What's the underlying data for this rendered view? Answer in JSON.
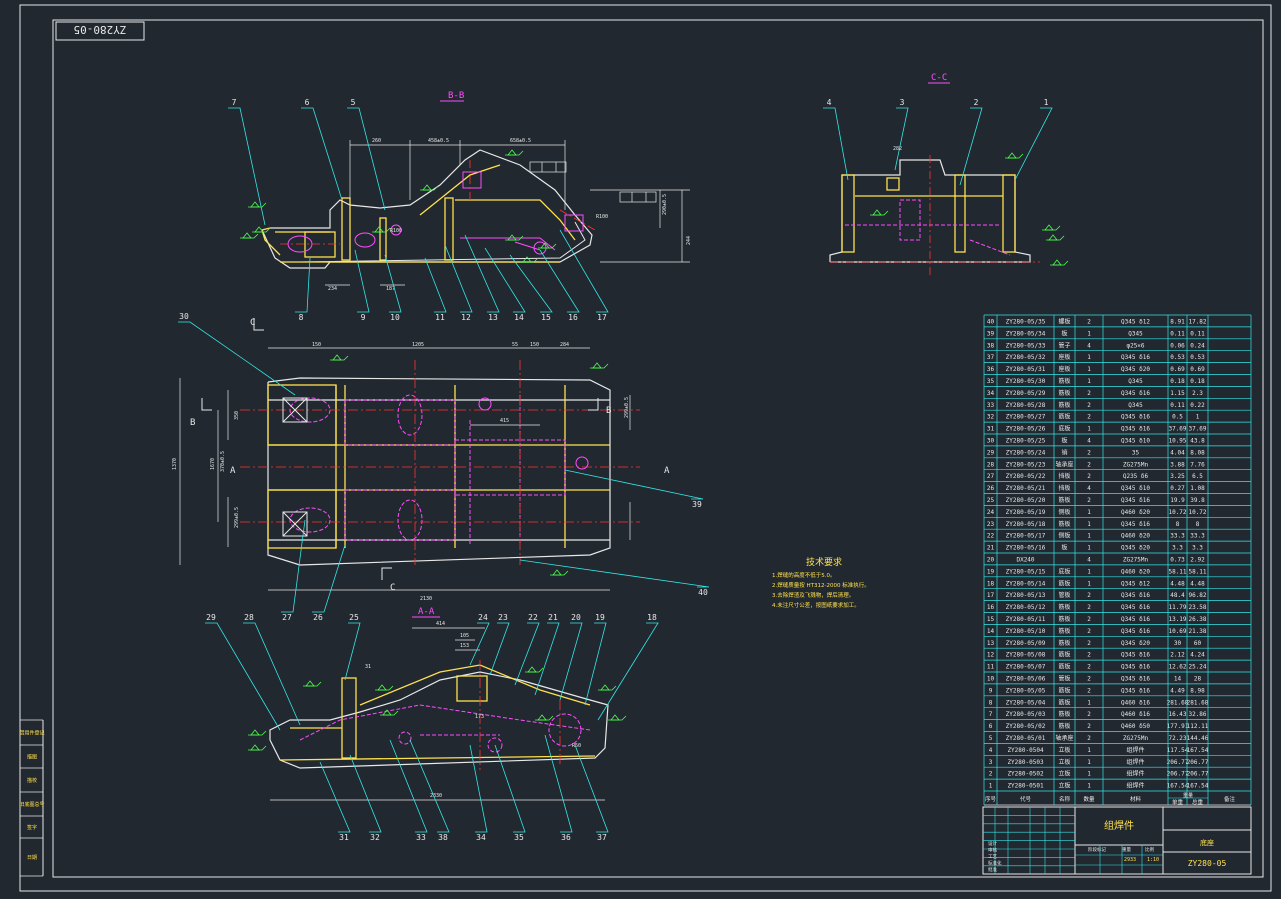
{
  "sheet_code": "ZY280-05",
  "views": {
    "bb": "B-B",
    "cc": "C-C",
    "aa": "A-A",
    "sec_a": "A",
    "sec_b": "B",
    "sec_c": "C"
  },
  "dims": {
    "bb": [
      "260",
      "458±0.5",
      "658±0.5",
      "290±0.5",
      "244",
      "234",
      "187",
      "R100",
      "R100"
    ],
    "plan": [
      "150",
      "1205",
      "55",
      "150",
      "284",
      "2130",
      "1370",
      "1670",
      "415",
      "350",
      "370±0.5",
      "299±0.5",
      "299±0.5"
    ],
    "aa": [
      "414",
      "105",
      "153",
      "2330",
      "31",
      "173",
      "R50"
    ],
    "cc": [
      "282"
    ]
  },
  "balloons_bb": [
    "7",
    "6",
    "5",
    "8",
    "9",
    "10",
    "11",
    "12",
    "13",
    "14",
    "15",
    "16",
    "17"
  ],
  "balloons_cc": [
    "4",
    "3",
    "2",
    "1"
  ],
  "balloons_plan": [
    "30",
    "27",
    "26",
    "39",
    "40"
  ],
  "balloons_aa": [
    "29",
    "28",
    "25",
    "24",
    "23",
    "22",
    "21",
    "20",
    "19",
    "18",
    "31",
    "32",
    "33",
    "38",
    "34",
    "35",
    "36",
    "37"
  ],
  "tech_req": {
    "title": "技术要求",
    "lines": [
      "1.焊缝的高度不低于5.0。",
      "2.焊缝质量按 HT312-2000 标准执行。",
      "3.去除焊渣及飞溅物，焊后清理。",
      "4.未注尺寸公差，按图纸要求加工。"
    ]
  },
  "bom_rows": [
    [
      "40",
      "ZY280-05/35",
      "螺板",
      "2",
      "Q345 δ12",
      "8.91",
      "17.82"
    ],
    [
      "39",
      "ZY280-05/34",
      "板",
      "1",
      "Q345",
      "0.11",
      "0.11"
    ],
    [
      "38",
      "ZY280-05/33",
      "管子",
      "4",
      "φ25×6",
      "0.06",
      "0.24"
    ],
    [
      "37",
      "ZY280-05/32",
      "座板",
      "1",
      "Q345 δ16",
      "0.53",
      "0.53"
    ],
    [
      "36",
      "ZY280-05/31",
      "座板",
      "1",
      "Q345 δ20",
      "0.69",
      "0.69"
    ],
    [
      "35",
      "ZY280-05/30",
      "筋板",
      "1",
      "Q345",
      "0.18",
      "0.18"
    ],
    [
      "34",
      "ZY280-05/29",
      "筋板",
      "2",
      "Q345 δ16",
      "1.15",
      "2.3"
    ],
    [
      "33",
      "ZY280-05/28",
      "筋板",
      "2",
      "Q345",
      "0.11",
      "0.22"
    ],
    [
      "32",
      "ZY280-05/27",
      "筋板",
      "2",
      "Q345 δ16",
      "0.5",
      "1"
    ],
    [
      "31",
      "ZY280-05/26",
      "底板",
      "1",
      "Q345 δ16",
      "37.69",
      "37.69"
    ],
    [
      "30",
      "ZY280-05/25",
      "板",
      "4",
      "Q345 δ10",
      "10.95",
      "43.8"
    ],
    [
      "29",
      "ZY280-05/24",
      "销",
      "2",
      "35",
      "4.04",
      "8.08"
    ],
    [
      "28",
      "ZY280-05/23",
      "轴承座",
      "2",
      "ZG275Mn",
      "3.88",
      "7.76"
    ],
    [
      "27",
      "ZY280-05/22",
      "挡板",
      "2",
      "Q235 δ6",
      "3.25",
      "6.5"
    ],
    [
      "26",
      "ZY280-05/21",
      "挡板",
      "4",
      "Q345 δ10",
      "0.27",
      "1.08"
    ],
    [
      "25",
      "ZY280-05/20",
      "筋板",
      "2",
      "Q345 δ16",
      "19.9",
      "39.8"
    ],
    [
      "24",
      "ZY280-05/19",
      "侧板",
      "1",
      "Q460 δ20",
      "10.72",
      "10.72"
    ],
    [
      "23",
      "ZY280-05/18",
      "筋板",
      "1",
      "Q345 δ16",
      "8",
      "8"
    ],
    [
      "22",
      "ZY280-05/17",
      "侧板",
      "1",
      "Q460 δ20",
      "33.3",
      "33.3"
    ],
    [
      "21",
      "ZY280-05/16",
      "板",
      "1",
      "Q345 δ20",
      "3.3",
      "3.3"
    ],
    [
      "20",
      "DX240",
      "",
      "4",
      "ZG275Mn",
      "0.73",
      "2.92"
    ],
    [
      "19",
      "ZY280-05/15",
      "底板",
      "1",
      "Q460 δ20",
      "58.11",
      "58.11"
    ],
    [
      "18",
      "ZY280-05/14",
      "筋板",
      "1",
      "Q345 δ12",
      "4.48",
      "4.48"
    ],
    [
      "17",
      "ZY280-05/13",
      "管板",
      "2",
      "Q345 δ16",
      "48.4",
      "96.82"
    ],
    [
      "16",
      "ZY280-05/12",
      "筋板",
      "2",
      "Q345 δ16",
      "11.79",
      "23.58"
    ],
    [
      "15",
      "ZY280-05/11",
      "筋板",
      "2",
      "Q345 δ16",
      "13.19",
      "26.38"
    ],
    [
      "14",
      "ZY280-05/10",
      "筋板",
      "2",
      "Q345 δ16",
      "10.69",
      "21.38"
    ],
    [
      "13",
      "ZY280-05/09",
      "筋板",
      "2",
      "Q345 δ20",
      "30",
      "60"
    ],
    [
      "12",
      "ZY280-05/08",
      "筋板",
      "2",
      "Q345 δ16",
      "2.12",
      "4.24"
    ],
    [
      "11",
      "ZY280-05/07",
      "筋板",
      "2",
      "Q345 δ16",
      "12.62",
      "25.24"
    ],
    [
      "10",
      "ZY280-05/06",
      "管板",
      "2",
      "Q345 δ16",
      "14",
      "28"
    ],
    [
      "9",
      "ZY280-05/05",
      "筋板",
      "2",
      "Q345 δ16",
      "4.49",
      "8.98"
    ],
    [
      "8",
      "ZY280-05/04",
      "筋板",
      "1",
      "Q460 δ16",
      "281.68",
      "281.68"
    ],
    [
      "7",
      "ZY280-05/03",
      "筋板",
      "2",
      "Q460 δ16",
      "16.43",
      "32.86"
    ],
    [
      "6",
      "ZY280-05/02",
      "筋板",
      "2",
      "Q460 δ50",
      "177.91",
      "112.11"
    ],
    [
      "5",
      "ZY280-05/01",
      "轴承座",
      "2",
      "ZG275Mn",
      "72.23",
      "144.46"
    ],
    [
      "4",
      "ZY280-0504",
      "立板",
      "1",
      "组焊件",
      "117.54",
      "167.54"
    ],
    [
      "3",
      "ZY280-0503",
      "立板",
      "1",
      "组焊件",
      "206.77",
      "206.77"
    ],
    [
      "2",
      "ZY280-0502",
      "立板",
      "1",
      "组焊件",
      "206.77",
      "206.77"
    ],
    [
      "1",
      "ZY280-0501",
      "立板",
      "1",
      "组焊件",
      "167.54",
      "167.54"
    ]
  ],
  "bom_header": [
    "序号",
    "代号",
    "名称",
    "数量",
    "材料",
    "单重",
    "总重",
    "备注"
  ],
  "bom_weight_label": "重量",
  "title_block": {
    "part_name": "组焊件",
    "company": "底座",
    "drawing_no": "ZY280-05",
    "weight": "2933",
    "scale": "1:10",
    "stage_label": "阶段标记",
    "weight_label": "重量",
    "scale_label": "比例",
    "row_labels": [
      "设计",
      "审核",
      "工艺",
      "标准化",
      "批准"
    ]
  },
  "side_labels": [
    "借用件登记",
    "描图",
    "描校",
    "旧底图总号",
    "签字",
    "日期"
  ]
}
